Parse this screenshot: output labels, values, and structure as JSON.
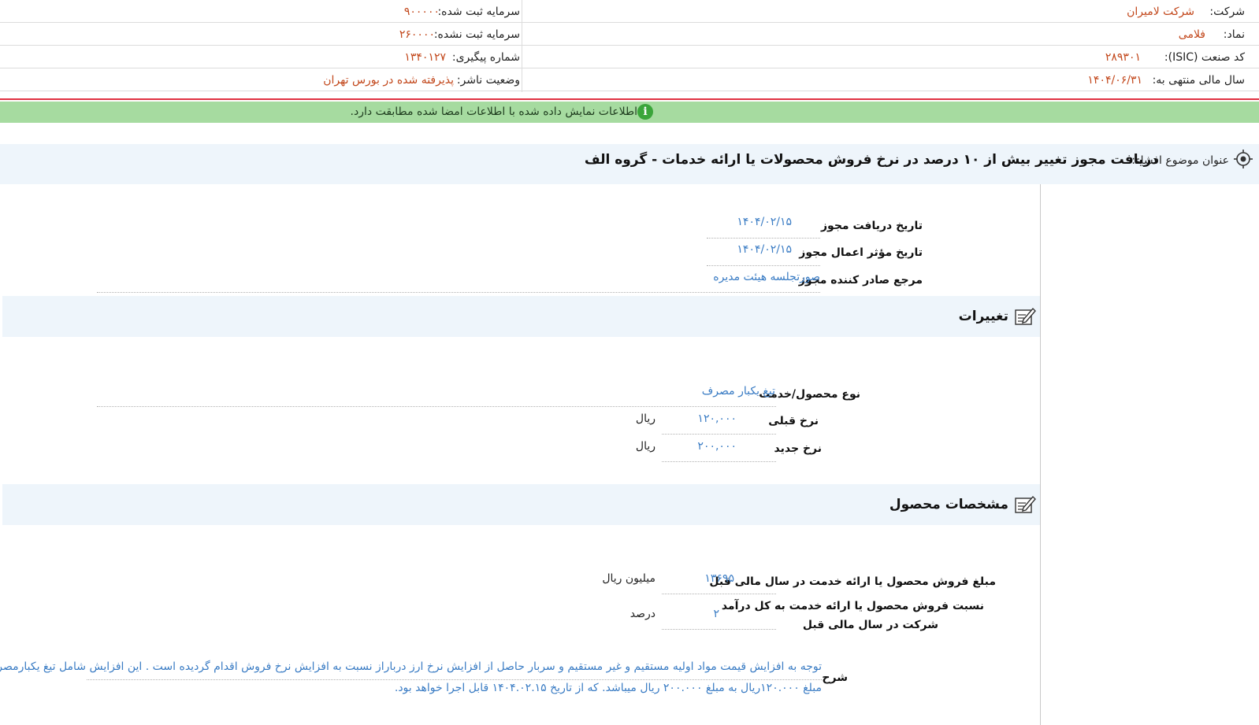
{
  "header": {
    "company_label": "شرکت:",
    "company_value": "شرکت لامیران",
    "symbol_label": "نماد:",
    "symbol_value": "فلامی",
    "isic_label": "کد صنعت (ISIC):",
    "isic_value": "۲۸۹۳۰۱",
    "fiscal_label": "سال مالی منتهی به:",
    "fiscal_value": "۱۴۰۴/۰۶/۳۱",
    "reg_capital_label": "سرمایه ثبت شده:",
    "reg_capital_value": "۹۰۰۰۰۰",
    "unreg_capital_label": "سرمایه ثبت نشده:",
    "unreg_capital_value": "۲۶۰۰۰۰",
    "tracking_label": "شماره پیگیری:",
    "tracking_value": "۱۳۴۰۱۲۷",
    "status_label": "وضعیت ناشر:",
    "status_value": "پذیرفته شده در بورس تهران"
  },
  "notice": {
    "message": "اطلاعات نمایش داده شده با اطلاعات امضا شده مطابقت دارد.",
    "icon_glyph": "i"
  },
  "disclosure": {
    "label": "عنوان موضوع افشاء:",
    "title": "دریافت مجوز تغییر بیش از ۱۰ درصد در نرخ فروش محصولات یا ارائه خدمات - گروه الف"
  },
  "permit": {
    "receive_date_label": "تاریخ دریافت مجوز",
    "receive_date_value": "۱۴۰۴/۰۲/۱۵",
    "effective_date_label": "تاریخ مؤثر اعمال مجوز",
    "effective_date_value": "۱۴۰۴/۰۲/۱۵",
    "issuer_label": "مرجع صادر کننده مجوز",
    "issuer_value": "صورتجلسه هیئت مدیره"
  },
  "changes": {
    "section_title": "تغییرات",
    "product_label": "نوع محصول/خدمت",
    "product_value": "تیغ یکبار مصرف",
    "prev_rate_label": "نرخ قبلی",
    "prev_rate_value": "۱۲۰,۰۰۰",
    "prev_rate_unit": "ریال",
    "new_rate_label": "نرخ جدید",
    "new_rate_value": "۲۰۰,۰۰۰",
    "new_rate_unit": "ریال"
  },
  "product": {
    "section_title": "مشخصات محصول",
    "sales_label": "مبلغ فروش محصول یا ارائه خدمت در سال مالی قبل",
    "sales_value": "۱۳۶۹۵",
    "sales_unit": "میلیون ریال",
    "ratio_label_line1": "نسبت فروش محصول یا ارائه خدمت به کل درآمد",
    "ratio_label_line2": "شرکت در سال مالی قبل",
    "ratio_value": "۲",
    "ratio_unit": "درصد"
  },
  "description": {
    "label": "شرح",
    "line1": "توجه به افزایش قیمت مواد اولیه مستقیم و غیر مستقیم و سربار حاصل از افزایش نرخ ارز درباراز نسبت به افزایش نرخ فروش اقدام گردیده است . این افزایش شامل تیغ یکبارمصرف از",
    "line2": "مبلغ ۱۲۰.۰۰۰ریال به مبلغ ۲۰۰.۰۰۰ ریال میباشد. که از تاریخ ۱۴۰۴.۰۲.۱۵ قابل اجرا خواهد بود."
  },
  "colors": {
    "accent_value": "#c2471b",
    "link_value": "#3a7cc4",
    "notice_bg": "#a6dba0",
    "section_bg": "#eef5fb",
    "alert_line": "#e03040"
  }
}
